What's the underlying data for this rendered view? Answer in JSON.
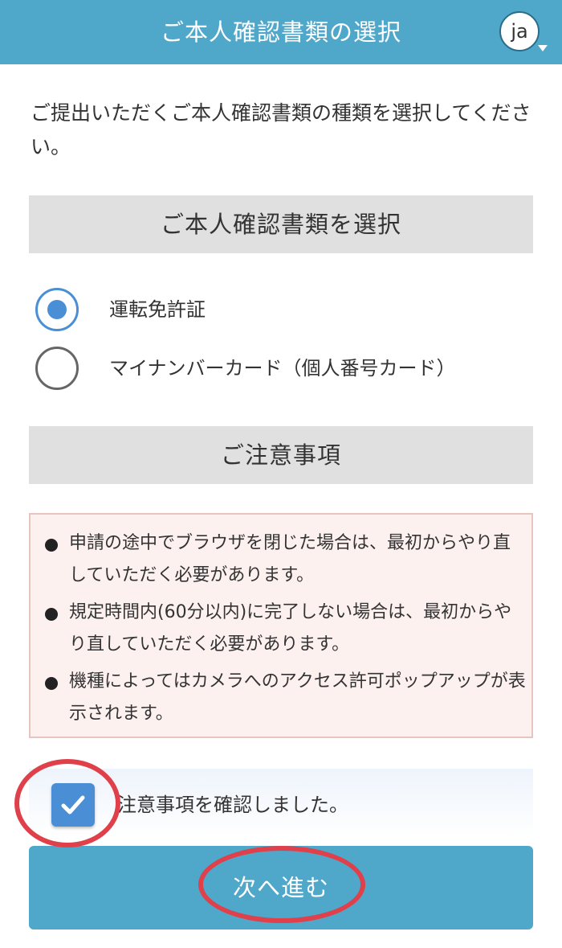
{
  "header": {
    "title": "ご本人確認書類の選択",
    "language": "ja"
  },
  "intro": "ご提出いただくご本人確認書類の種類を選択してください。",
  "document_select": {
    "heading": "ご本人確認書類を選択",
    "options": [
      {
        "label": "運転免許証",
        "selected": true
      },
      {
        "label": "マイナンバーカード（個人番号カード）",
        "selected": false
      }
    ]
  },
  "notes": {
    "heading": "ご注意事項",
    "items": [
      "申請の途中でブラウザを閉じた場合は、最初からやり直していただく必要があります。",
      "規定時間内(60分以内)に完了しない場合は、最初からやり直していただく必要があります。",
      "機種によってはカメラへのアクセス許可ポップアップが表示されます。"
    ]
  },
  "confirm": {
    "label": "注意事項を確認しました。",
    "checked": true
  },
  "next_button": {
    "label": "次へ進む"
  },
  "colors": {
    "header": "#4fa7c9",
    "accent": "#4a8fd6",
    "notice_bg": "#fdf1f0",
    "annotation": "#e04049"
  }
}
